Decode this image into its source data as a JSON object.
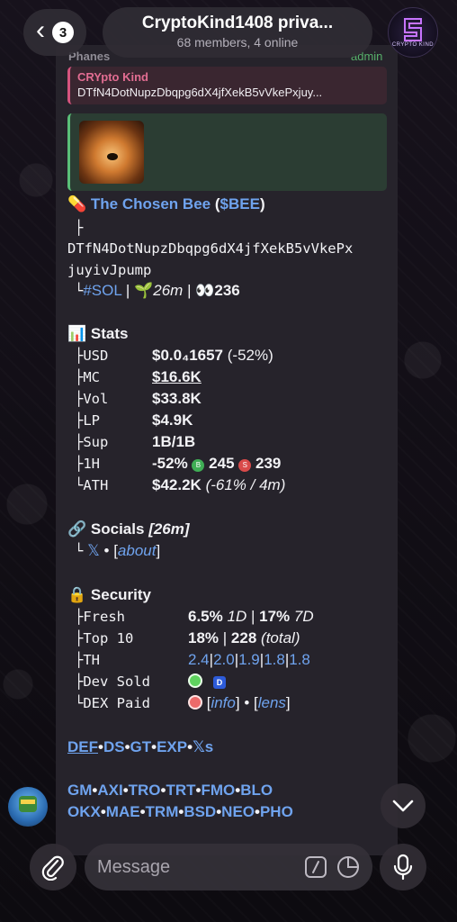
{
  "header": {
    "back_count": "3",
    "title": "CryptoKind1408 priva...",
    "subtitle": "68 members, 4 online",
    "avatar_text": "CRYPTO KIND"
  },
  "message": {
    "sender": "Phanes",
    "role": "admin",
    "reply": {
      "author": "CRYpto Kind",
      "text": "DTfN4DotNupzDbqpg6dX4jfXekB5vVkePxjuy..."
    },
    "token": {
      "pill_emoji": "💊",
      "name": "The Chosen Bee",
      "ticker": "$BEE",
      "tree_top": "├",
      "address_line1": "DTfN4DotNupzDbqpg6dX4jfXekB5vVkePx",
      "address_line2": "juyivJpump",
      "tree_end": "└",
      "chain": "#SOL",
      "age_emoji": "🌱",
      "age": "26m",
      "views_emoji": "👀",
      "views": "236"
    },
    "stats": {
      "emoji": "📊",
      "title": "Stats",
      "rows": [
        {
          "prefix": "├",
          "label": "USD",
          "value": "$0.0₄1657",
          "extra": "(-52%)"
        },
        {
          "prefix": "├",
          "label": "MC",
          "value": "$16.6K"
        },
        {
          "prefix": "├",
          "label": "Vol",
          "value": "$33.8K"
        },
        {
          "prefix": "├",
          "label": "LP",
          "value": "$4.9K"
        },
        {
          "prefix": "├",
          "label": "Sup",
          "value": "1B/1B"
        },
        {
          "prefix": "├",
          "label": "1H",
          "value": "-52%",
          "buys": "245",
          "sells": "239"
        },
        {
          "prefix": "└",
          "label": "ATH",
          "value": "$42.2K",
          "extra": "(-61% / 4m)"
        }
      ]
    },
    "socials": {
      "emoji": "🔗",
      "title": "Socials",
      "age": "[26m]",
      "prefix": "└",
      "x_label": "𝕏",
      "sep": "•",
      "about": "about"
    },
    "security": {
      "emoji": "🔒",
      "title": "Security",
      "fresh": {
        "prefix": "├",
        "label": "Fresh",
        "v1": "6.5%",
        "p1": "1D",
        "v2": "17%",
        "p2": "7D"
      },
      "top10": {
        "prefix": "├",
        "label": "Top 10",
        "v1": "18%",
        "v2": "228",
        "note": "(total)"
      },
      "th": {
        "prefix": "├",
        "label": "TH",
        "values": [
          "2.4",
          "2.0",
          "1.9",
          "1.8",
          "1.8"
        ]
      },
      "dev_sold": {
        "prefix": "├",
        "label": "Dev Sold",
        "badge": "D"
      },
      "dex_paid": {
        "prefix": "└",
        "label": "DEX Paid",
        "info": "info",
        "lens": "lens"
      }
    },
    "links_row1": [
      "DEF",
      "DS",
      "GT",
      "EXP",
      "𝕏s"
    ],
    "links_row2": [
      "GM",
      "AXI",
      "TRO",
      "TRT",
      "FMO",
      "BLO"
    ],
    "links_row3": [
      "OKX",
      "MAE",
      "TRM",
      "BSD",
      "NEO",
      "PHO"
    ],
    "separator": "•",
    "bar": "|"
  },
  "composer": {
    "placeholder": "Message"
  },
  "colors": {
    "link": "#6fa3ee",
    "green_dot": "#5fd35f",
    "red_dot": "#ec6a6a",
    "bubble": "#26232b"
  }
}
